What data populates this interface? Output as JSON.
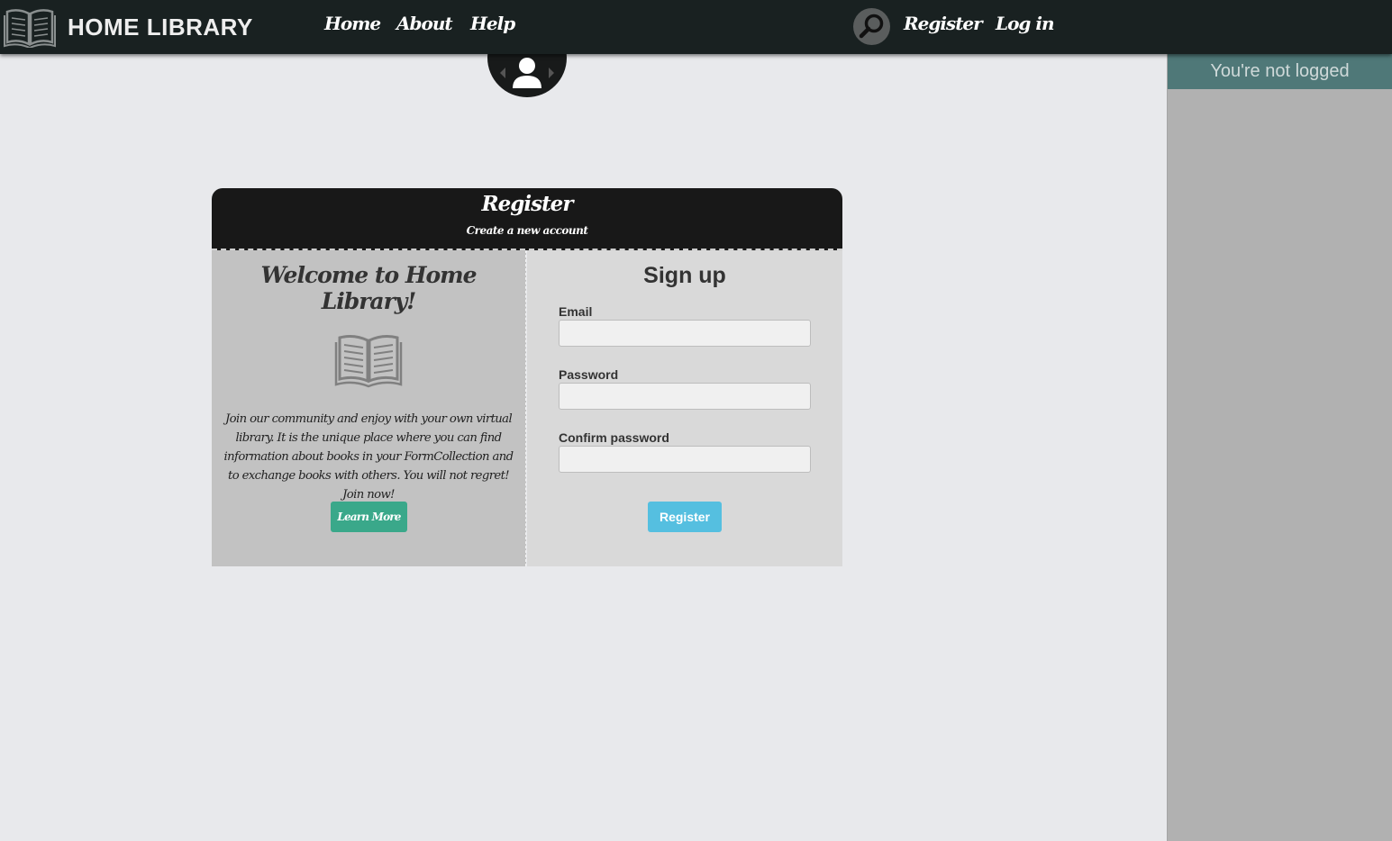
{
  "navbar": {
    "brand": "HOME LIBRARY",
    "links": [
      "Home",
      "About",
      "Help"
    ],
    "register_label": "Register",
    "login_label": "Log in"
  },
  "sidebar": {
    "status": "You're not logged"
  },
  "card": {
    "title": "Register",
    "subtitle": "Create a new account",
    "welcome_title": "Welcome to Home Library!",
    "welcome_text": "Join our community and enjoy with your own virtual library. It is the unique place where you can find information about books in your FormCollection and to exchange books with others. You will not regret! Join now!",
    "learn_more": "Learn More",
    "signup_title": "Sign up",
    "email_label": "Email",
    "email_value": "",
    "password_label": "Password",
    "password_value": "",
    "confirm_label": "Confirm password",
    "confirm_value": "",
    "register_button": "Register"
  },
  "colors": {
    "navbar": "#192121",
    "sidebar_header": "#4f7878",
    "learn_more": "#3aa88a",
    "register": "#55bfe0"
  }
}
